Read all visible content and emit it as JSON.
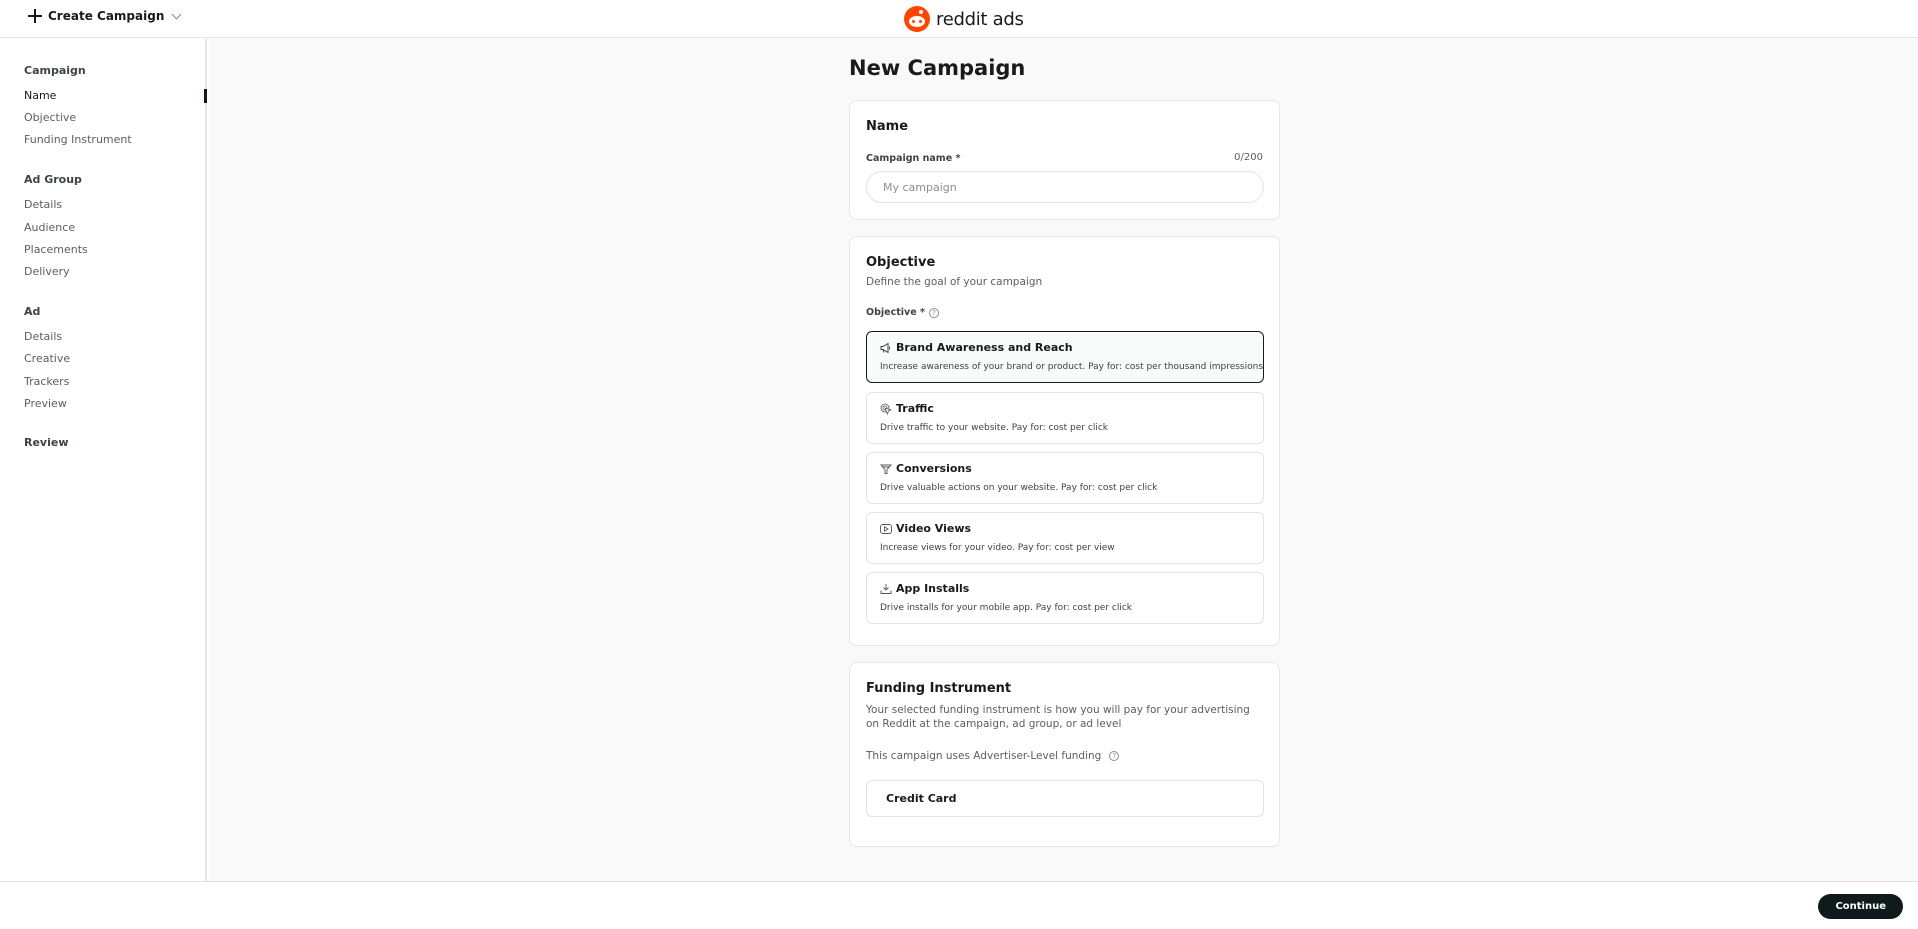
{
  "topbar": {
    "create_label": "Create Campaign",
    "brand_name": "reddit",
    "brand_suffix": "ads"
  },
  "sidebar": {
    "sections": [
      {
        "title": "Campaign",
        "items": [
          "Name",
          "Objective",
          "Funding Instrument"
        ]
      },
      {
        "title": "Ad Group",
        "items": [
          "Details",
          "Audience",
          "Placements",
          "Delivery"
        ]
      },
      {
        "title": "Ad",
        "items": [
          "Details",
          "Creative",
          "Trackers",
          "Preview"
        ]
      },
      {
        "title": "Review",
        "items": []
      }
    ],
    "active_item": "Name"
  },
  "main": {
    "page_title": "New Campaign",
    "name_card": {
      "title": "Name",
      "field_label": "Campaign name *",
      "counter": "0/200",
      "value": "",
      "placeholder": "My campaign"
    },
    "objective_card": {
      "title": "Objective",
      "description": "Define the goal of your campaign",
      "field_label": "Objective *",
      "help_icon": "?",
      "selected": "Brand Awareness and Reach",
      "options": [
        {
          "icon": "megaphone-icon",
          "title": "Brand Awareness and Reach",
          "description": "Increase awareness of your brand or product. Pay for: cost per thousand impressions"
        },
        {
          "icon": "cursor-click-icon",
          "title": "Traffic",
          "description": "Drive traffic to your website. Pay for: cost per click"
        },
        {
          "icon": "funnel-icon",
          "title": "Conversions",
          "description": "Drive valuable actions on your website. Pay for: cost per click"
        },
        {
          "icon": "play-icon",
          "title": "Video Views",
          "description": "Increase views for your video. Pay for: cost per view"
        },
        {
          "icon": "download-icon",
          "title": "App Installs",
          "description": "Drive installs for your mobile app. Pay for: cost per click"
        }
      ]
    },
    "funding_card": {
      "title": "Funding Instrument",
      "description": "Your selected funding instrument is how you will pay for your advertising on Reddit at the campaign, ad group, or ad level",
      "note": "This campaign uses Advertiser-Level funding",
      "help_icon": "?",
      "instrument": "Credit Card"
    }
  },
  "footer": {
    "continue_label": "Continue"
  },
  "colors": {
    "brand_orange": "#ff4500",
    "primary_button": "#0f1a1c",
    "page_background": "#f9f9f9"
  }
}
